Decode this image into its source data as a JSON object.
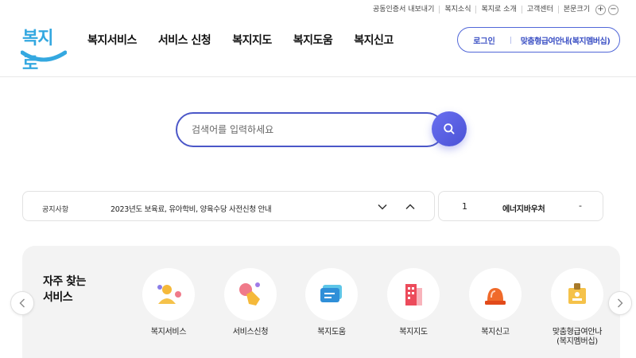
{
  "utility": {
    "cert_export": "공동인증서 내보내기",
    "news": "복지소식",
    "about": "복지로 소개",
    "support": "고객센터",
    "font_size": "본문크기",
    "plus": "+",
    "minus": "−"
  },
  "logo": {
    "text": "복지로"
  },
  "gnb": [
    {
      "label": "복지서비스"
    },
    {
      "label": "서비스 신청"
    },
    {
      "label": "복지지도"
    },
    {
      "label": "복지도움"
    },
    {
      "label": "복지신고"
    }
  ],
  "header": {
    "login": "로그인",
    "custom_guide": "맞춤형급여안내(복지멤버십)"
  },
  "search": {
    "placeholder": "검색어를 입력하세요"
  },
  "notice": {
    "label": "공지사항",
    "text": "2023년도 보육료, 유아학비, 양육수당 사전신청 안내"
  },
  "energy": {
    "index": "1",
    "text": "에너지바우처",
    "value": "-"
  },
  "services": {
    "title_line1": "자주 찾는",
    "title_line2": "서비스",
    "items": [
      {
        "label": "복지서비스",
        "icon": "person-icon"
      },
      {
        "label": "서비스신청",
        "icon": "hand-click-icon"
      },
      {
        "label": "복지도움",
        "icon": "chat-bubble-icon"
      },
      {
        "label": "복지지도",
        "icon": "map-building-icon"
      },
      {
        "label": "복지신고",
        "icon": "siren-icon"
      },
      {
        "label_line1": "맞춤형급여안나",
        "label_line2": "(복지멤버십)",
        "icon": "id-card-icon"
      }
    ]
  },
  "colors": {
    "brand_blue": "#4b57c8",
    "logo_blue": "#34a8e0",
    "panel_bg": "#f3f3f3"
  }
}
